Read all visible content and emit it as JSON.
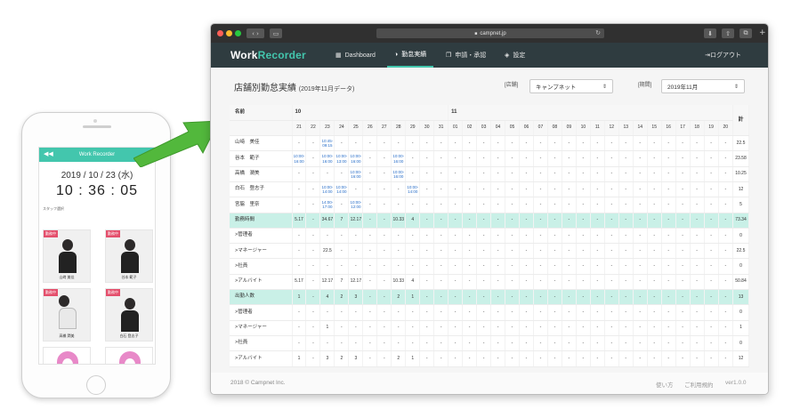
{
  "phone": {
    "header_title": "Work Recorder",
    "back_icon": "double-chevron-left-icon",
    "date": "2019 / 10 / 23 (水)",
    "time": "10 : 36 : 05",
    "staff_label": "スタッフ選択",
    "cards": [
      {
        "badge": "勤務中",
        "name": "山﨑 美佳"
      },
      {
        "badge": "勤務中",
        "name": "谷本 範子"
      },
      {
        "badge": "勤務中",
        "name": "高橋 潤美"
      },
      {
        "badge": "勤務中",
        "name": "白石 登志子"
      }
    ]
  },
  "browser": {
    "url": "campnet.jp",
    "lock_icon": "lock-icon",
    "logo_prefix": "Work",
    "logo_suffix": "Recorder",
    "nav": [
      {
        "icon": "grid-icon",
        "label": "Dashboard"
      },
      {
        "icon": "half-circle-icon",
        "label": "勤怠実績"
      },
      {
        "icon": "copy-icon",
        "label": "申請・承認"
      },
      {
        "icon": "layers-icon",
        "label": "設定"
      }
    ],
    "logout": "ログアウト",
    "accent_color": "#43c6ad",
    "nav_bg": "#2f3c40"
  },
  "main": {
    "title": "店舗別勤怠実績",
    "subtitle": "(2019年11月データ)",
    "store_label": "[店舗]",
    "store_value": "キャンプネット",
    "period_label": "[期間]",
    "period_value": "2019年11月",
    "table": {
      "name_header": "名前",
      "total_header": "計",
      "month_oct": "10",
      "month_nov": "11",
      "days": [
        "21",
        "22",
        "23",
        "24",
        "25",
        "26",
        "27",
        "28",
        "29",
        "30",
        "31",
        "01",
        "02",
        "03",
        "04",
        "05",
        "06",
        "07",
        "08",
        "09",
        "10",
        "11",
        "12",
        "13",
        "14",
        "15",
        "16",
        "17",
        "18",
        "19",
        "20"
      ],
      "rows": [
        {
          "name": "山﨑　美佳",
          "group": false,
          "cells": [
            "-",
            "-",
            "10:45-\n09:15",
            "-",
            "-",
            "-",
            "-",
            "-",
            "-",
            "-",
            "-",
            "-",
            "-",
            "-",
            "-",
            "-",
            "-",
            "-",
            "-",
            "-",
            "-",
            "-",
            "-",
            "-",
            "-",
            "-",
            "-",
            "-",
            "-",
            "-",
            "-"
          ],
          "total": "22.5"
        },
        {
          "name": "谷本　範子",
          "group": false,
          "cells": [
            "10:00-\n16:00",
            "-",
            "10:00-\n16:00",
            "10:00-\n13:00",
            "10:00-\n16:00",
            "-",
            "-",
            "10:00-\n16:00",
            "-",
            "-",
            "-",
            "-",
            "-",
            "-",
            "-",
            "-",
            "-",
            "-",
            "-",
            "-",
            "-",
            "-",
            "-",
            "-",
            "-",
            "-",
            "-",
            "-",
            "-",
            "-",
            "-"
          ],
          "total": "23.58"
        },
        {
          "name": "高橋　潤美",
          "group": false,
          "cells": [
            "-",
            "-",
            "-",
            "-",
            "10:00-\n16:00",
            "-",
            "-",
            "10:00-\n16:00",
            "-",
            "-",
            "-",
            "-",
            "-",
            "-",
            "-",
            "-",
            "-",
            "-",
            "-",
            "-",
            "-",
            "-",
            "-",
            "-",
            "-",
            "-",
            "-",
            "-",
            "-",
            "-",
            "-"
          ],
          "total": "10.25"
        },
        {
          "name": "白石　登志子",
          "group": false,
          "cells": [
            "-",
            "-",
            "10:00-\n14:00",
            "10:00-\n14:00",
            "-",
            "-",
            "-",
            "-",
            "10:00-\n14:00",
            "-",
            "-",
            "-",
            "-",
            "-",
            "-",
            "-",
            "-",
            "-",
            "-",
            "-",
            "-",
            "-",
            "-",
            "-",
            "-",
            "-",
            "-",
            "-",
            "-",
            "-",
            "-"
          ],
          "total": "12"
        },
        {
          "name": "宮脇　里奈",
          "group": false,
          "cells": [
            "-",
            "-",
            "14:00-\n17:00",
            "-",
            "10:00-\n12:00",
            "-",
            "-",
            "-",
            "-",
            "-",
            "-",
            "-",
            "-",
            "-",
            "-",
            "-",
            "-",
            "-",
            "-",
            "-",
            "-",
            "-",
            "-",
            "-",
            "-",
            "-",
            "-",
            "-",
            "-",
            "-",
            "-"
          ],
          "total": "5"
        },
        {
          "name": "勤務時間",
          "group": true,
          "cells": [
            "5.17",
            "-",
            "34.67",
            "7",
            "12.17",
            "-",
            "-",
            "10.33",
            "4",
            "-",
            "-",
            "-",
            "-",
            "-",
            "-",
            "-",
            "-",
            "-",
            "-",
            "-",
            "-",
            "-",
            "-",
            "-",
            "-",
            "-",
            "-",
            "-",
            "-",
            "-",
            "-"
          ],
          "total": "73.34"
        },
        {
          "name": ">管理者",
          "group": false,
          "cells": [
            "-",
            "-",
            "-",
            "-",
            "-",
            "-",
            "-",
            "-",
            "-",
            "-",
            "-",
            "-",
            "-",
            "-",
            "-",
            "-",
            "-",
            "-",
            "-",
            "-",
            "-",
            "-",
            "-",
            "-",
            "-",
            "-",
            "-",
            "-",
            "-",
            "-",
            "-"
          ],
          "total": "0"
        },
        {
          "name": ">マネージャー",
          "group": false,
          "cells": [
            "-",
            "-",
            "22.5",
            "-",
            "-",
            "-",
            "-",
            "-",
            "-",
            "-",
            "-",
            "-",
            "-",
            "-",
            "-",
            "-",
            "-",
            "-",
            "-",
            "-",
            "-",
            "-",
            "-",
            "-",
            "-",
            "-",
            "-",
            "-",
            "-",
            "-",
            "-"
          ],
          "total": "22.5"
        },
        {
          "name": ">社員",
          "group": false,
          "cells": [
            "-",
            "-",
            "-",
            "-",
            "-",
            "-",
            "-",
            "-",
            "-",
            "-",
            "-",
            "-",
            "-",
            "-",
            "-",
            "-",
            "-",
            "-",
            "-",
            "-",
            "-",
            "-",
            "-",
            "-",
            "-",
            "-",
            "-",
            "-",
            "-",
            "-",
            "-"
          ],
          "total": "0"
        },
        {
          "name": ">アルバイト",
          "group": false,
          "cells": [
            "5.17",
            "-",
            "12.17",
            "7",
            "12.17",
            "-",
            "-",
            "10.33",
            "4",
            "-",
            "-",
            "-",
            "-",
            "-",
            "-",
            "-",
            "-",
            "-",
            "-",
            "-",
            "-",
            "-",
            "-",
            "-",
            "-",
            "-",
            "-",
            "-",
            "-",
            "-",
            "-"
          ],
          "total": "50.84"
        },
        {
          "name": "出勤人数",
          "group": true,
          "cells": [
            "1",
            "-",
            "4",
            "2",
            "3",
            "-",
            "-",
            "2",
            "1",
            "-",
            "-",
            "-",
            "-",
            "-",
            "-",
            "-",
            "-",
            "-",
            "-",
            "-",
            "-",
            "-",
            "-",
            "-",
            "-",
            "-",
            "-",
            "-",
            "-",
            "-",
            "-"
          ],
          "total": "13"
        },
        {
          "name": ">管理者",
          "group": false,
          "cells": [
            "-",
            "-",
            "-",
            "-",
            "-",
            "-",
            "-",
            "-",
            "-",
            "-",
            "-",
            "-",
            "-",
            "-",
            "-",
            "-",
            "-",
            "-",
            "-",
            "-",
            "-",
            "-",
            "-",
            "-",
            "-",
            "-",
            "-",
            "-",
            "-",
            "-",
            "-"
          ],
          "total": "0"
        },
        {
          "name": ">マネージャー",
          "group": false,
          "cells": [
            "-",
            "-",
            "1",
            "-",
            "-",
            "-",
            "-",
            "-",
            "-",
            "-",
            "-",
            "-",
            "-",
            "-",
            "-",
            "-",
            "-",
            "-",
            "-",
            "-",
            "-",
            "-",
            "-",
            "-",
            "-",
            "-",
            "-",
            "-",
            "-",
            "-",
            "-"
          ],
          "total": "1"
        },
        {
          "name": ">社員",
          "group": false,
          "cells": [
            "-",
            "-",
            "-",
            "-",
            "-",
            "-",
            "-",
            "-",
            "-",
            "-",
            "-",
            "-",
            "-",
            "-",
            "-",
            "-",
            "-",
            "-",
            "-",
            "-",
            "-",
            "-",
            "-",
            "-",
            "-",
            "-",
            "-",
            "-",
            "-",
            "-",
            "-"
          ],
          "total": "0"
        },
        {
          "name": ">アルバイト",
          "group": false,
          "cells": [
            "1",
            "-",
            "3",
            "2",
            "3",
            "-",
            "-",
            "2",
            "1",
            "-",
            "-",
            "-",
            "-",
            "-",
            "-",
            "-",
            "-",
            "-",
            "-",
            "-",
            "-",
            "-",
            "-",
            "-",
            "-",
            "-",
            "-",
            "-",
            "-",
            "-",
            "-"
          ],
          "total": "12"
        }
      ]
    }
  },
  "footer": {
    "copyright": "2018 © Campnet Inc.",
    "help": "使い方",
    "terms": "ご利用規約",
    "version": "ver1.0.0"
  }
}
